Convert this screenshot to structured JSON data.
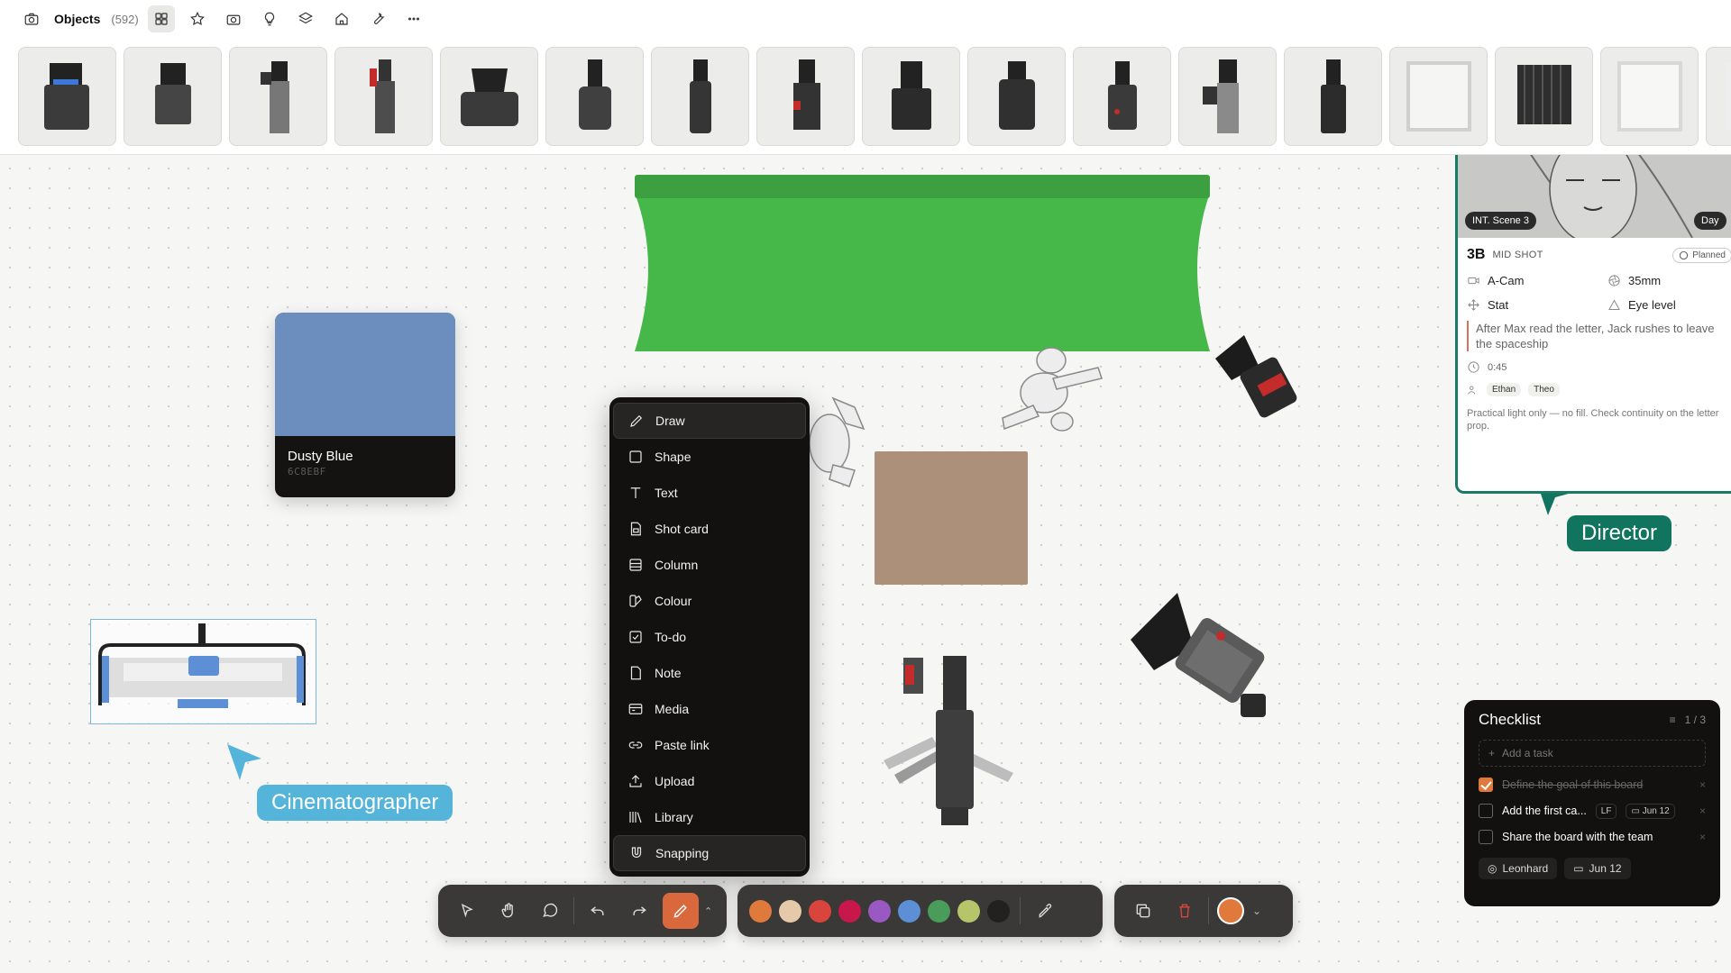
{
  "topbar": {
    "title": "Objects",
    "count": "(592)"
  },
  "strip": {
    "item_count": 16
  },
  "colour_card": {
    "name": "Dusty Blue",
    "hex": "6C8EBF",
    "color": "#6c8ebf"
  },
  "menu": {
    "items": [
      {
        "label": "Draw",
        "icon": "pen-icon"
      },
      {
        "label": "Shape",
        "icon": "square-icon"
      },
      {
        "label": "Text",
        "icon": "text-icon"
      },
      {
        "label": "Shot card",
        "icon": "shot-card-icon"
      },
      {
        "label": "Column",
        "icon": "column-icon"
      },
      {
        "label": "Colour",
        "icon": "palette-icon"
      },
      {
        "label": "To-do",
        "icon": "checkbox-icon"
      },
      {
        "label": "Note",
        "icon": "note-icon"
      },
      {
        "label": "Media",
        "icon": "media-icon"
      },
      {
        "label": "Paste link",
        "icon": "link-icon"
      },
      {
        "label": "Upload",
        "icon": "upload-icon"
      },
      {
        "label": "Library",
        "icon": "library-icon"
      },
      {
        "label": "Snapping",
        "icon": "magnet-icon"
      }
    ]
  },
  "cursors": {
    "cinematographer": "Cinematographer",
    "director": "Director",
    "cinematographer_color": "#55b4d9",
    "director_color": "#11745f"
  },
  "shot_card": {
    "scene": "INT. Scene 3",
    "time": "Day",
    "id": "3B",
    "type": "MID SHOT",
    "status": "Planned",
    "camera": "A-Cam",
    "lens": "35mm",
    "movement": "Stat",
    "angle": "Eye level",
    "description": "After Max read the letter, Jack rushes to leave the spaceship",
    "duration": "0:45",
    "cast": [
      "Ethan",
      "Theo"
    ],
    "note": "Practical light only — no fill. Check continuity on the letter prop."
  },
  "checklist": {
    "title": "Checklist",
    "count": "1 / 3",
    "add_placeholder": "Add a task",
    "tasks": [
      {
        "text": "Define the goal of this board",
        "done": true
      },
      {
        "text": "Add the first ca...",
        "done": false,
        "assignee": "LF",
        "due": "Jun 12"
      },
      {
        "text": "Share the board with the team",
        "done": false
      }
    ],
    "footer_assignee": "Leonhard",
    "footer_due": "Jun 12"
  },
  "palette": [
    "#e07a3c",
    "#e6c9a8",
    "#d9453d",
    "#c8174a",
    "#9a59c2",
    "#5d8fd6",
    "#4a9c5a",
    "#b6c46a",
    "#222120"
  ],
  "current_color": "#e07a3c",
  "accent": "#d9683d"
}
